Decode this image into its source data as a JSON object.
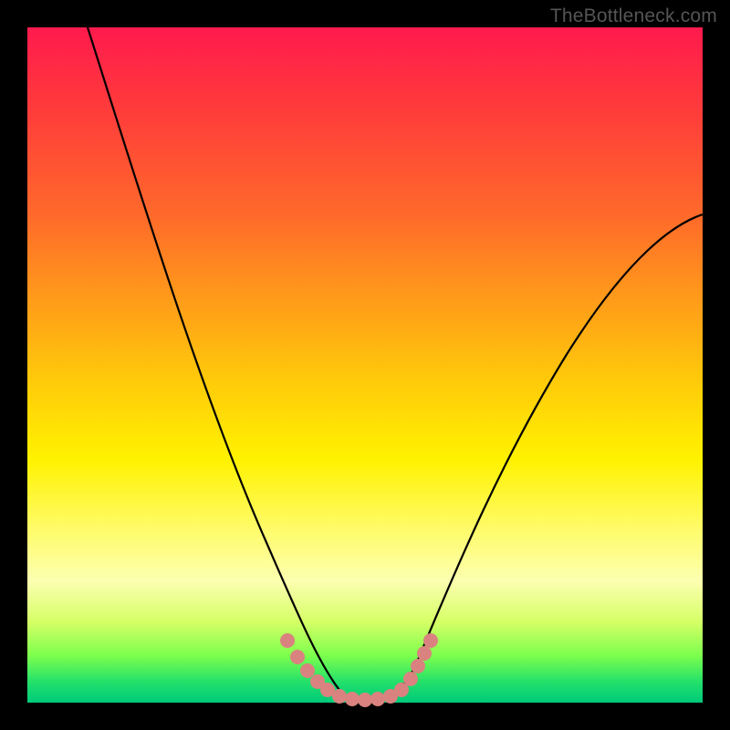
{
  "watermark": "TheBottleneck.com",
  "colors": {
    "background": "#000000",
    "gradient_top": "#ff1a4d",
    "gradient_bottom": "#00c97a",
    "curve": "#000000",
    "marker": "#d9827f"
  },
  "chart_data": {
    "type": "line",
    "title": "",
    "xlabel": "",
    "ylabel": "",
    "xlim": [
      0,
      100
    ],
    "ylim": [
      0,
      100
    ],
    "series": [
      {
        "name": "left-curve",
        "x": [
          9,
          12,
          16,
          20,
          25,
          30,
          33,
          35,
          37,
          39,
          41,
          43,
          45,
          50
        ],
        "y": [
          100,
          88,
          74,
          60,
          44,
          28,
          20,
          14,
          10,
          6,
          4,
          2,
          1,
          0
        ]
      },
      {
        "name": "right-curve",
        "x": [
          50,
          55,
          57,
          60,
          65,
          70,
          78,
          88,
          100
        ],
        "y": [
          0,
          1,
          3,
          8,
          18,
          30,
          48,
          62,
          72
        ]
      }
    ],
    "markers": {
      "name": "bottom-markers",
      "points": [
        {
          "x": 38,
          "y": 8.5
        },
        {
          "x": 39.5,
          "y": 6.0
        },
        {
          "x": 41,
          "y": 4.0
        },
        {
          "x": 42.5,
          "y": 2.5
        },
        {
          "x": 44,
          "y": 1.2
        },
        {
          "x": 46,
          "y": 0.6
        },
        {
          "x": 48,
          "y": 0.3
        },
        {
          "x": 50,
          "y": 0.2
        },
        {
          "x": 52,
          "y": 0.3
        },
        {
          "x": 54,
          "y": 0.6
        },
        {
          "x": 55.5,
          "y": 1.4
        },
        {
          "x": 57,
          "y": 3.0
        },
        {
          "x": 58,
          "y": 5.0
        },
        {
          "x": 59,
          "y": 7.0
        },
        {
          "x": 60,
          "y": 9.0
        }
      ]
    }
  }
}
